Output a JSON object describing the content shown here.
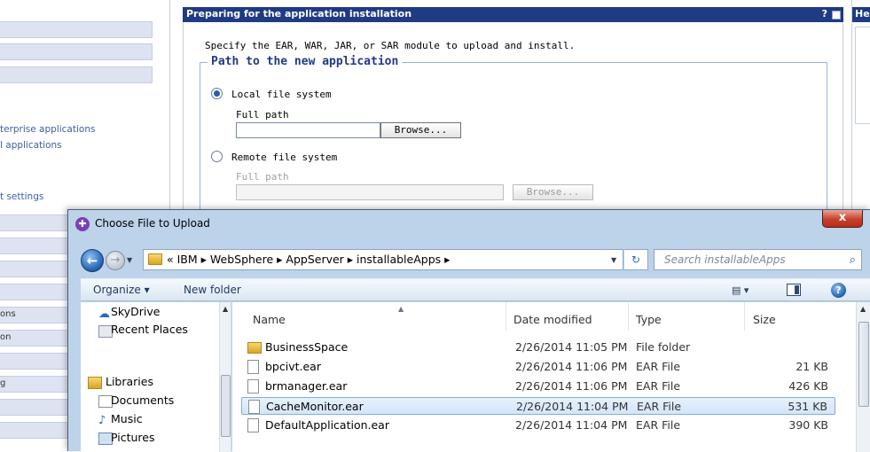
{
  "nav": {
    "links": [
      "terprise applications",
      "l applications",
      "t settings"
    ],
    "items": [
      "ons",
      "on",
      "g"
    ]
  },
  "main": {
    "title": "Preparing for the application installation",
    "help_glyph": "?",
    "instruction": "Specify the EAR, WAR, JAR, or SAR module to upload and install.",
    "legend": "Path to the new application",
    "local_label": "Local file system",
    "local_fullpath_label": "Full path",
    "local_fullpath_value": "",
    "browse_label": "Browse...",
    "remote_label": "Remote file system",
    "remote_fullpath_label": "Full path",
    "remote_fullpath_value": "",
    "remote_browse_label": "Browse..."
  },
  "right_panel": {
    "title": "He"
  },
  "dialog": {
    "title": "Choose File to Upload",
    "close_glyph": "x",
    "address": "« IBM ▸ WebSphere ▸ AppServer ▸ installableApps ▸",
    "search_placeholder": "Search installableApps",
    "organize_label": "Organize ▾",
    "new_folder_label": "New folder",
    "view_label": "▤ ▾",
    "help_label": "?",
    "nav_pane": [
      {
        "label": "SkyDrive",
        "icon": "cloud-icon"
      },
      {
        "label": "Recent Places",
        "icon": "recent-places-icon"
      },
      {
        "label": "Libraries",
        "icon": "libraries-icon"
      },
      {
        "label": "Documents",
        "icon": "documents-icon"
      },
      {
        "label": "Music",
        "icon": "music-icon"
      },
      {
        "label": "Pictures",
        "icon": "pictures-icon"
      }
    ],
    "columns": {
      "name": "Name",
      "date": "Date modified",
      "type": "Type",
      "size": "Size"
    },
    "files": [
      {
        "name": "BusinessSpace",
        "date": "2/26/2014 11:05 PM",
        "type": "File folder",
        "size": "",
        "folder": true
      },
      {
        "name": "bpcivt.ear",
        "date": "2/26/2014 11:06 PM",
        "type": "EAR File",
        "size": "21 KB"
      },
      {
        "name": "brmanager.ear",
        "date": "2/26/2014 11:06 PM",
        "type": "EAR File",
        "size": "426 KB"
      },
      {
        "name": "CacheMonitor.ear",
        "date": "2/26/2014 11:04 PM",
        "type": "EAR File",
        "size": "531 KB",
        "selected": true
      },
      {
        "name": "DefaultApplication.ear",
        "date": "2/26/2014 11:04 PM",
        "type": "EAR File",
        "size": "390 KB"
      }
    ]
  }
}
